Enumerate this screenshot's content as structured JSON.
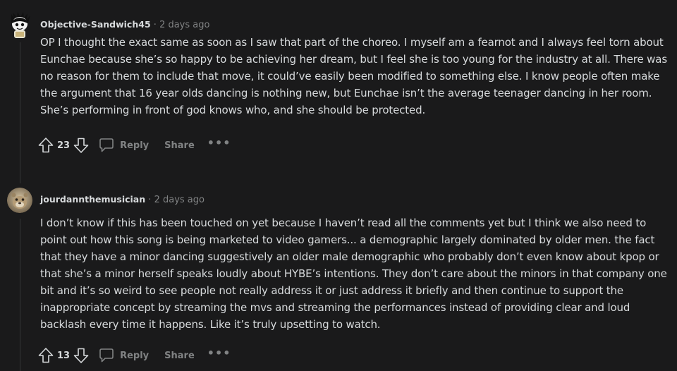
{
  "comments": [
    {
      "author": "Objective-Sandwich45",
      "separator": "·",
      "time": "2 days ago",
      "body": "OP I thought the exact same as soon as I saw that part of the choreo. I myself am a fearnot and I always feel torn about Eunchae because she’s so happy to be achieving her dream, but I feel she is too young for the industry at all. There was no reason for them to include that move, it could’ve easily been modified to something else. I know people often make the argument that 16 year olds dancing is nothing new, but Eunchae isn’t the average teenager dancing in her room. She’s performing in front of god knows who, and she should be protected.",
      "score": "23",
      "reply_label": "Reply",
      "share_label": "Share",
      "more_label": "•••",
      "icons": {
        "avatar": "snoo-avatar-icon",
        "upvote": "upvote-arrow-icon",
        "downvote": "downvote-arrow-icon",
        "reply": "speech-bubble-icon"
      }
    },
    {
      "author": "jourdannthemusician",
      "separator": "·",
      "time": "2 days ago",
      "body": "I don’t know if this has been touched on yet because I haven’t read all the comments yet but I think we also need to point out how this song is being marketed to video gamers... a demographic largely dominated by older men. the fact that they have a minor dancing suggestively an older male demographic who probably don’t even know about kpop or that she’s a minor herself speaks loudly about HYBE’s intentions. They don’t care about the minors in that company one bit and it’s so weird to see people not really address it or just address it briefly and then continue to support the inappropriate concept by streaming the mvs and streaming the performances instead of providing clear and loud backlash every time it happens. Like it’s truly upsetting to watch.",
      "score": "13",
      "reply_label": "Reply",
      "share_label": "Share",
      "more_label": "•••",
      "icons": {
        "avatar": "user-avatar-icon",
        "upvote": "upvote-arrow-icon",
        "downvote": "downvote-arrow-icon",
        "reply": "speech-bubble-icon"
      }
    }
  ],
  "colors": {
    "background": "#1a1a1b",
    "text": "#d7dadc",
    "muted": "#818384",
    "thread_line": "#343536"
  }
}
